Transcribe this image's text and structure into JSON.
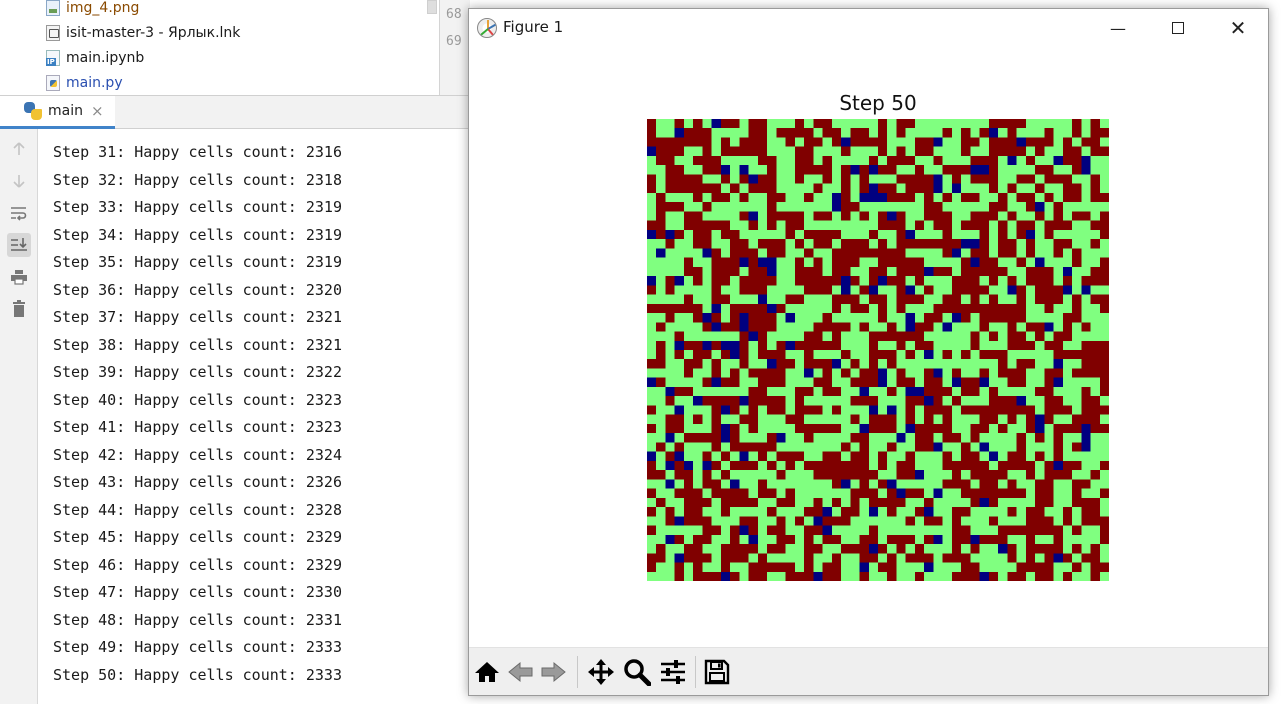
{
  "project_tree": {
    "items": [
      {
        "label": "img_4.png",
        "icon": "png-file-icon",
        "color": "#8a4a00"
      },
      {
        "label": "isit-master-3 - Ярлык.lnk",
        "icon": "shortcut-file-icon",
        "color": "#1a1a1a"
      },
      {
        "label": "main.ipynb",
        "icon": "notebook-file-icon",
        "color": "#1a1a1a",
        "badge": "IP"
      },
      {
        "label": "main.py",
        "icon": "python-file-icon",
        "color": "#2a4fb0"
      }
    ]
  },
  "editor": {
    "gutter_lines": [
      "68",
      "69"
    ]
  },
  "run_panel": {
    "tab_label": "main",
    "tab_close": "×",
    "toolbar": [
      "up-arrow-icon",
      "down-arrow-icon",
      "soft-wrap-icon",
      "scroll-to-end-icon",
      "print-icon",
      "trash-icon"
    ],
    "console_lines": [
      "Step 31: Happy cells count: 2316",
      "Step 32: Happy cells count: 2318",
      "Step 33: Happy cells count: 2319",
      "Step 34: Happy cells count: 2319",
      "Step 35: Happy cells count: 2319",
      "Step 36: Happy cells count: 2320",
      "Step 37: Happy cells count: 2321",
      "Step 38: Happy cells count: 2321",
      "Step 39: Happy cells count: 2322",
      "Step 40: Happy cells count: 2323",
      "Step 41: Happy cells count: 2323",
      "Step 42: Happy cells count: 2324",
      "Step 43: Happy cells count: 2326",
      "Step 44: Happy cells count: 2328",
      "Step 45: Happy cells count: 2329",
      "Step 46: Happy cells count: 2329",
      "Step 47: Happy cells count: 2330",
      "Step 48: Happy cells count: 2331",
      "Step 49: Happy cells count: 2333",
      "Step 50: Happy cells count: 2333"
    ]
  },
  "figure_window": {
    "title": "Figure 1",
    "controls": {
      "minimize": "—",
      "close": "✕"
    },
    "plot": {
      "title": "Step 50",
      "type": "heatmap",
      "grid_size": 50,
      "colors": {
        "red": "#800000",
        "green": "#80ff80",
        "blue": "#000080"
      }
    },
    "toolbar": [
      "home-icon",
      "back-arrow-icon",
      "forward-arrow-icon",
      "pan-icon",
      "zoom-icon",
      "subplots-config-icon",
      "save-icon"
    ]
  }
}
